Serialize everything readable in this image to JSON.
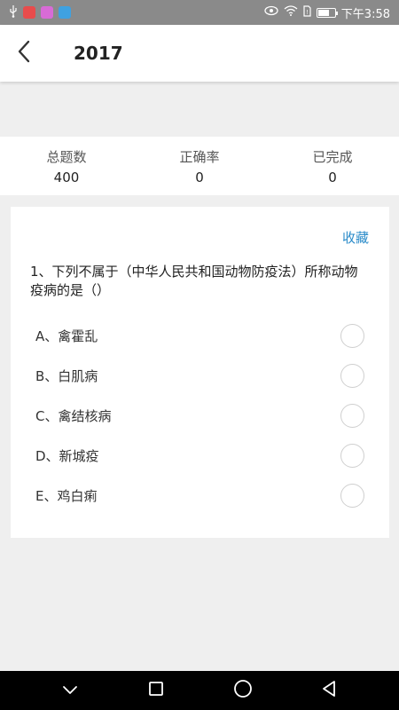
{
  "status_bar": {
    "time": "下午3:58",
    "left_icons": [
      "usb-icon",
      "app-icon-1",
      "app-icon-2",
      "app-icon-3"
    ],
    "right_icons": [
      "eye-icon",
      "wifi-icon",
      "sim-icon",
      "battery-icon"
    ],
    "app_colors": [
      "#e84c4c",
      "#d86bd6",
      "#3fa1e0"
    ]
  },
  "header": {
    "title": "2017",
    "back_icon": "chevron-left-icon"
  },
  "stats": [
    {
      "label": "总题数",
      "value": "400"
    },
    {
      "label": "正确率",
      "value": "0"
    },
    {
      "label": "已完成",
      "value": "0"
    }
  ],
  "card": {
    "favorite_label": "收藏",
    "question": "1、下列不属于（中华人民共和国动物防疫法）所称动物疫病的是（）",
    "options": [
      {
        "text": "A、禽霍乱"
      },
      {
        "text": "B、白肌病"
      },
      {
        "text": "C、禽结核病"
      },
      {
        "text": "D、新城疫"
      },
      {
        "text": "E、鸡白痢"
      }
    ]
  },
  "colors": {
    "accent": "#2a8bc9",
    "background": "#efefef",
    "status_bar": "#8a8a8a"
  },
  "nav_bar": [
    "nav-collapse-icon",
    "nav-recents-icon",
    "nav-home-icon",
    "nav-back-icon"
  ]
}
